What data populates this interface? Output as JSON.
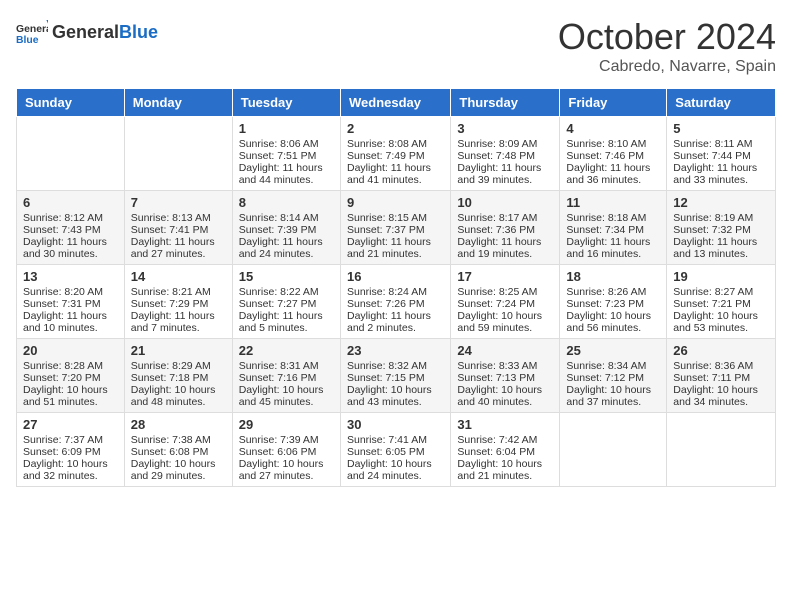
{
  "header": {
    "logo_general": "General",
    "logo_blue": "Blue",
    "month": "October 2024",
    "location": "Cabredo, Navarre, Spain"
  },
  "weekdays": [
    "Sunday",
    "Monday",
    "Tuesday",
    "Wednesday",
    "Thursday",
    "Friday",
    "Saturday"
  ],
  "weeks": [
    [
      {
        "day": "",
        "sunrise": "",
        "sunset": "",
        "daylight": ""
      },
      {
        "day": "",
        "sunrise": "",
        "sunset": "",
        "daylight": ""
      },
      {
        "day": "1",
        "sunrise": "Sunrise: 8:06 AM",
        "sunset": "Sunset: 7:51 PM",
        "daylight": "Daylight: 11 hours and 44 minutes."
      },
      {
        "day": "2",
        "sunrise": "Sunrise: 8:08 AM",
        "sunset": "Sunset: 7:49 PM",
        "daylight": "Daylight: 11 hours and 41 minutes."
      },
      {
        "day": "3",
        "sunrise": "Sunrise: 8:09 AM",
        "sunset": "Sunset: 7:48 PM",
        "daylight": "Daylight: 11 hours and 39 minutes."
      },
      {
        "day": "4",
        "sunrise": "Sunrise: 8:10 AM",
        "sunset": "Sunset: 7:46 PM",
        "daylight": "Daylight: 11 hours and 36 minutes."
      },
      {
        "day": "5",
        "sunrise": "Sunrise: 8:11 AM",
        "sunset": "Sunset: 7:44 PM",
        "daylight": "Daylight: 11 hours and 33 minutes."
      }
    ],
    [
      {
        "day": "6",
        "sunrise": "Sunrise: 8:12 AM",
        "sunset": "Sunset: 7:43 PM",
        "daylight": "Daylight: 11 hours and 30 minutes."
      },
      {
        "day": "7",
        "sunrise": "Sunrise: 8:13 AM",
        "sunset": "Sunset: 7:41 PM",
        "daylight": "Daylight: 11 hours and 27 minutes."
      },
      {
        "day": "8",
        "sunrise": "Sunrise: 8:14 AM",
        "sunset": "Sunset: 7:39 PM",
        "daylight": "Daylight: 11 hours and 24 minutes."
      },
      {
        "day": "9",
        "sunrise": "Sunrise: 8:15 AM",
        "sunset": "Sunset: 7:37 PM",
        "daylight": "Daylight: 11 hours and 21 minutes."
      },
      {
        "day": "10",
        "sunrise": "Sunrise: 8:17 AM",
        "sunset": "Sunset: 7:36 PM",
        "daylight": "Daylight: 11 hours and 19 minutes."
      },
      {
        "day": "11",
        "sunrise": "Sunrise: 8:18 AM",
        "sunset": "Sunset: 7:34 PM",
        "daylight": "Daylight: 11 hours and 16 minutes."
      },
      {
        "day": "12",
        "sunrise": "Sunrise: 8:19 AM",
        "sunset": "Sunset: 7:32 PM",
        "daylight": "Daylight: 11 hours and 13 minutes."
      }
    ],
    [
      {
        "day": "13",
        "sunrise": "Sunrise: 8:20 AM",
        "sunset": "Sunset: 7:31 PM",
        "daylight": "Daylight: 11 hours and 10 minutes."
      },
      {
        "day": "14",
        "sunrise": "Sunrise: 8:21 AM",
        "sunset": "Sunset: 7:29 PM",
        "daylight": "Daylight: 11 hours and 7 minutes."
      },
      {
        "day": "15",
        "sunrise": "Sunrise: 8:22 AM",
        "sunset": "Sunset: 7:27 PM",
        "daylight": "Daylight: 11 hours and 5 minutes."
      },
      {
        "day": "16",
        "sunrise": "Sunrise: 8:24 AM",
        "sunset": "Sunset: 7:26 PM",
        "daylight": "Daylight: 11 hours and 2 minutes."
      },
      {
        "day": "17",
        "sunrise": "Sunrise: 8:25 AM",
        "sunset": "Sunset: 7:24 PM",
        "daylight": "Daylight: 10 hours and 59 minutes."
      },
      {
        "day": "18",
        "sunrise": "Sunrise: 8:26 AM",
        "sunset": "Sunset: 7:23 PM",
        "daylight": "Daylight: 10 hours and 56 minutes."
      },
      {
        "day": "19",
        "sunrise": "Sunrise: 8:27 AM",
        "sunset": "Sunset: 7:21 PM",
        "daylight": "Daylight: 10 hours and 53 minutes."
      }
    ],
    [
      {
        "day": "20",
        "sunrise": "Sunrise: 8:28 AM",
        "sunset": "Sunset: 7:20 PM",
        "daylight": "Daylight: 10 hours and 51 minutes."
      },
      {
        "day": "21",
        "sunrise": "Sunrise: 8:29 AM",
        "sunset": "Sunset: 7:18 PM",
        "daylight": "Daylight: 10 hours and 48 minutes."
      },
      {
        "day": "22",
        "sunrise": "Sunrise: 8:31 AM",
        "sunset": "Sunset: 7:16 PM",
        "daylight": "Daylight: 10 hours and 45 minutes."
      },
      {
        "day": "23",
        "sunrise": "Sunrise: 8:32 AM",
        "sunset": "Sunset: 7:15 PM",
        "daylight": "Daylight: 10 hours and 43 minutes."
      },
      {
        "day": "24",
        "sunrise": "Sunrise: 8:33 AM",
        "sunset": "Sunset: 7:13 PM",
        "daylight": "Daylight: 10 hours and 40 minutes."
      },
      {
        "day": "25",
        "sunrise": "Sunrise: 8:34 AM",
        "sunset": "Sunset: 7:12 PM",
        "daylight": "Daylight: 10 hours and 37 minutes."
      },
      {
        "day": "26",
        "sunrise": "Sunrise: 8:36 AM",
        "sunset": "Sunset: 7:11 PM",
        "daylight": "Daylight: 10 hours and 34 minutes."
      }
    ],
    [
      {
        "day": "27",
        "sunrise": "Sunrise: 7:37 AM",
        "sunset": "Sunset: 6:09 PM",
        "daylight": "Daylight: 10 hours and 32 minutes."
      },
      {
        "day": "28",
        "sunrise": "Sunrise: 7:38 AM",
        "sunset": "Sunset: 6:08 PM",
        "daylight": "Daylight: 10 hours and 29 minutes."
      },
      {
        "day": "29",
        "sunrise": "Sunrise: 7:39 AM",
        "sunset": "Sunset: 6:06 PM",
        "daylight": "Daylight: 10 hours and 27 minutes."
      },
      {
        "day": "30",
        "sunrise": "Sunrise: 7:41 AM",
        "sunset": "Sunset: 6:05 PM",
        "daylight": "Daylight: 10 hours and 24 minutes."
      },
      {
        "day": "31",
        "sunrise": "Sunrise: 7:42 AM",
        "sunset": "Sunset: 6:04 PM",
        "daylight": "Daylight: 10 hours and 21 minutes."
      },
      {
        "day": "",
        "sunrise": "",
        "sunset": "",
        "daylight": ""
      },
      {
        "day": "",
        "sunrise": "",
        "sunset": "",
        "daylight": ""
      }
    ]
  ]
}
